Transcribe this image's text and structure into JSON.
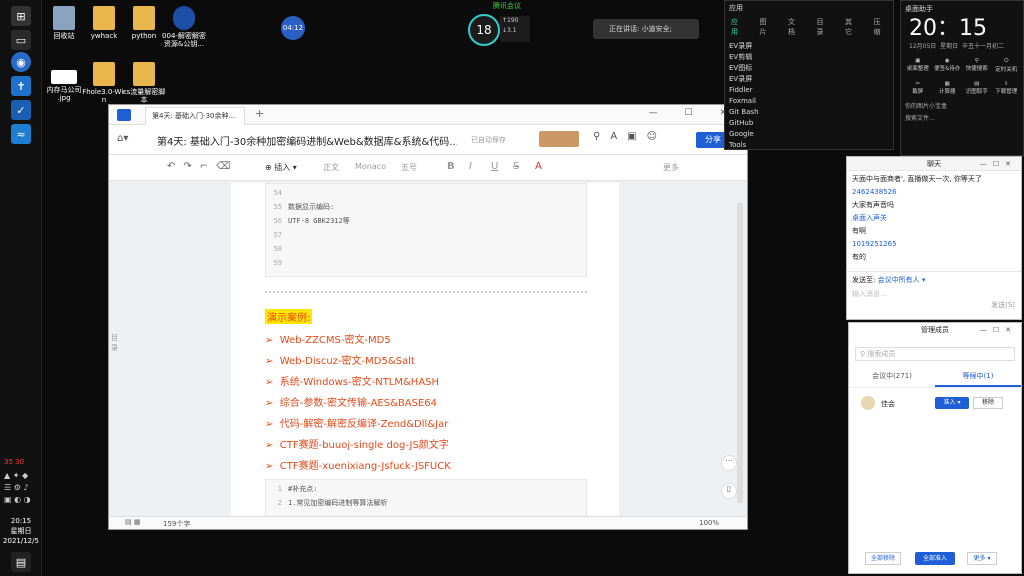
{
  "taskbar": {
    "clock_time": "20:15",
    "clock_day": "星期日",
    "clock_date": "2021/12/5",
    "tray_nums": "35 30"
  },
  "desktop": {
    "icons": [
      {
        "label": "回收站"
      },
      {
        "label": "ywhack"
      },
      {
        "label": "python"
      },
      {
        "label": "004-解密解密\n资源&公钥..."
      },
      {
        "label": "内存马公司\n.jpg"
      },
      {
        "label": "Fhole3.0-Wi-n"
      },
      {
        "label": "cs流量解密脚本"
      }
    ]
  },
  "meeting": {
    "badge": "04:12",
    "temp": "18",
    "speed_up": "190",
    "speed_down": "3.1",
    "speed_unit": "K/s",
    "top_label": "腾讯会议",
    "speaker": "正在讲话: 小迪安全;"
  },
  "editor": {
    "tab_title": "第4天: 基础入门-30余种...",
    "doc_title": "第4天: 基础入门-30余种加密编码进制&Web&数据库&系统&代码...",
    "save_label": "已自动保存",
    "share_label": "分享",
    "insert_label": "插入",
    "fmt": {
      "body": "正文",
      "font": "Monaco",
      "size": "五号",
      "bold": "B",
      "italic": "I",
      "underline": "U",
      "strike": "S",
      "color": "A",
      "more": "更多"
    },
    "code1": [
      {
        "n": "54",
        "t": ""
      },
      {
        "n": "55",
        "t": "数据显示编码:"
      },
      {
        "n": "56",
        "t": "UTF-8 GBK2312等"
      },
      {
        "n": "57",
        "t": ""
      },
      {
        "n": "58",
        "t": ""
      },
      {
        "n": "59",
        "t": ""
      }
    ],
    "highlight": "演示案例:",
    "cases": [
      "Web-ZZCMS-密文-MD5",
      "Web-Discuz-密文-MD5&Salt",
      "系统-Windows-密文-NTLM&HASH",
      "综合-参数-密文传输-AES&BASE64",
      "代码-解密-解密反编译-Zend&Dll&Jar",
      "CTF赛题-buuoj-single dog-JS颜文字",
      "CTF赛题-xuenixiang-Jsfuck-JSFUCK"
    ],
    "code2": [
      {
        "n": "1",
        "t": "#补充点:"
      },
      {
        "n": "2",
        "t": "1.常见加密编码进制等算法解析"
      }
    ],
    "status": {
      "words": "159个字",
      "zoom": "100%"
    },
    "side_label": "目录"
  },
  "clock_panel": {
    "title": "桌面助手",
    "time": "20：15",
    "date": "12月05日",
    "weekday": "星期日",
    "lunar": "辛丑十一月初二",
    "items": [
      "桌面整理",
      "便签&待办",
      "快捷搜索",
      "定时关机",
      "截屏",
      "计算器",
      "识图取字",
      "下载管理"
    ],
    "folder": "你的图片小宝盒",
    "search": "搜索文件..."
  },
  "app_panel": {
    "title": "应用",
    "tabs": [
      "应用",
      "图片",
      "文档",
      "目录",
      "其它",
      "压缩"
    ],
    "items": [
      "EV录屏",
      "EV剪辑",
      "EV图标",
      "EV录屏",
      "Fiddler",
      "Foxmail",
      "Git Bash",
      "GitHub",
      "Google",
      "Tools"
    ]
  },
  "chat": {
    "title": "聊天",
    "messages": [
      {
        "text": "天面中与面商者', 直播做天一次, 你等天了",
        "blue": false
      },
      {
        "text": "2462438526",
        "blue": true
      },
      {
        "text": "大家有声音吗",
        "blue": false
      },
      {
        "text": "桌面入声关",
        "blue": true
      },
      {
        "text": "有啊",
        "blue": false
      },
      {
        "text": "1019251265",
        "blue": true
      },
      {
        "text": "有的",
        "blue": false
      }
    ],
    "send_to_label": "发送至:",
    "send_to_value": "会议中所有人",
    "input_placeholder": "输入消息...",
    "send_label": "发送(S)"
  },
  "members": {
    "title": "管理成员",
    "search_placeholder": "搜索成员",
    "tab_in": "会议中(271)",
    "tab_wait": "等候中(1)",
    "member_name": "佳会",
    "admit_label": "准入",
    "remove_label": "移除",
    "footer": {
      "remove_all": "全部移除",
      "admit_all": "全部准入",
      "more": "更多"
    }
  }
}
